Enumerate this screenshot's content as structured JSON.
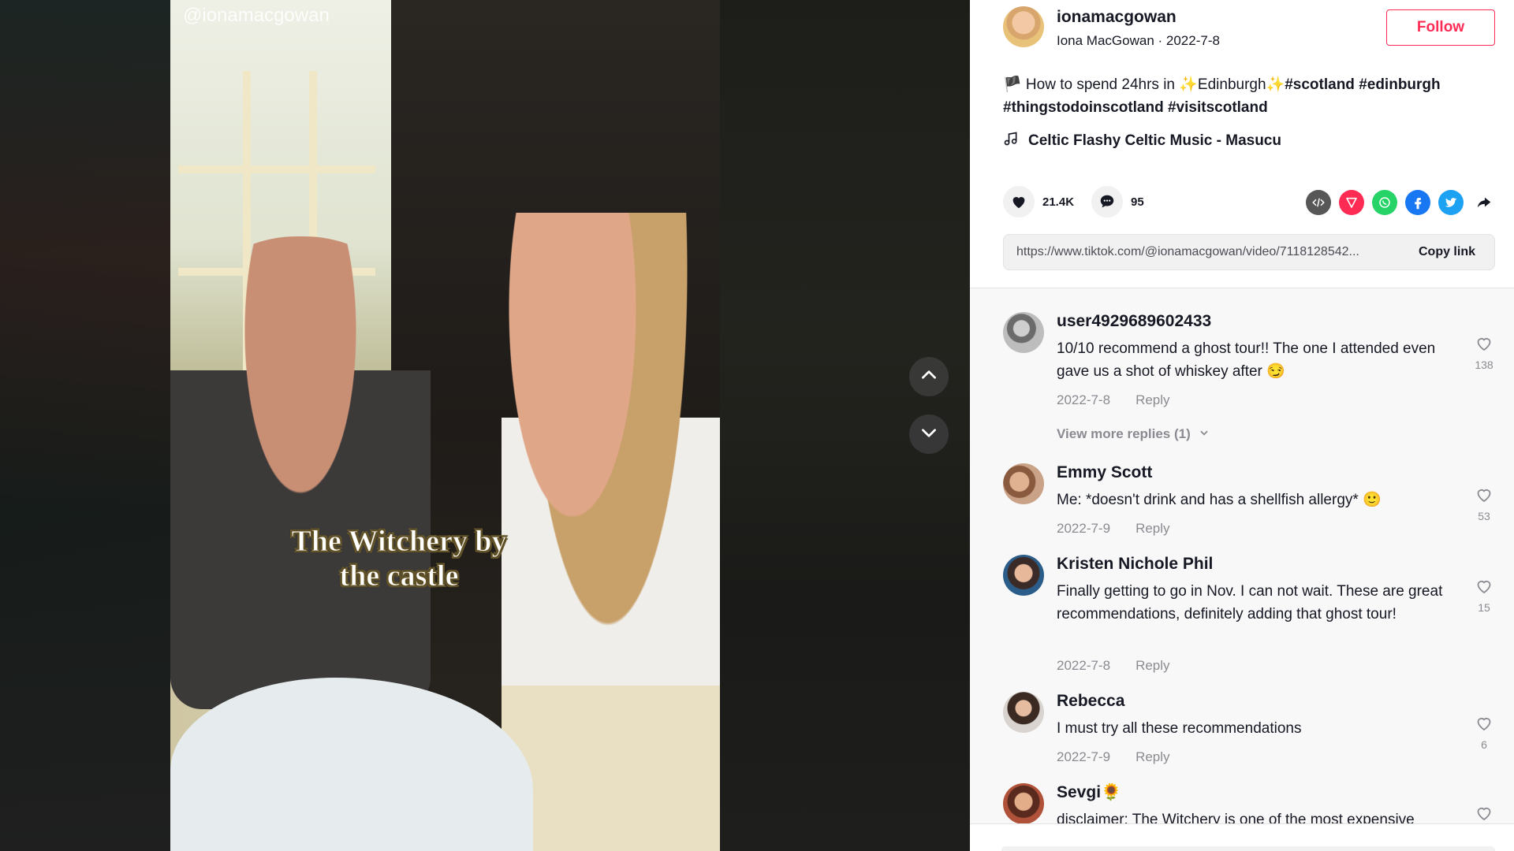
{
  "video": {
    "watermark": "@ionamacgowan",
    "caption": "The Witchery by the castle"
  },
  "post": {
    "username": "ionamacgowan",
    "display_name": "Iona MacGowan",
    "date": "2022-7-8",
    "subline": "Iona MacGowan · 2022-7-8",
    "follow_label": "Follow",
    "description_text": "🏴 How to spend 24hrs in ✨Edinburgh✨",
    "description_tags": "#scotland #edinburgh #thingstodoinscotland #visitscotland",
    "music": "Celtic Flashy Celtic Music - Masucu",
    "likes": "21.4K",
    "comments_count": "95",
    "link_url": "https://www.tiktok.com/@ionamacgowan/video/7118128542...",
    "copy_link_label": "Copy link"
  },
  "colors": {
    "accent": "#fe2c55",
    "text": "#161823",
    "muted": "#8a8b91",
    "share_embed": "#575757",
    "share_send": "#fe2c55",
    "share_whatsapp": "#25d366",
    "share_facebook": "#1877f2",
    "share_twitter": "#1da1f2"
  },
  "comments": [
    {
      "name": "user4929689602433",
      "text": "10/10 recommend a ghost tour!! The one I attended even gave us a shot of whiskey after 😏",
      "date": "2022-7-8",
      "reply": "Reply",
      "likes": "138",
      "more_replies": "View more replies (1)"
    },
    {
      "name": "Emmy Scott",
      "text": "Me: *doesn't drink and has a shellfish allergy* 🙂",
      "date": "2022-7-9",
      "reply": "Reply",
      "likes": "53"
    },
    {
      "name": "Kristen Nichole Phil",
      "text": "Finally getting to go in Nov. I can not wait. These are great recommendations, definitely adding that ghost tour!",
      "date": "2022-7-8",
      "reply": "Reply",
      "likes": "15"
    },
    {
      "name": "Rebecca",
      "text": "I must try all these recommendations",
      "date": "2022-7-9",
      "reply": "Reply",
      "likes": "6"
    },
    {
      "name": "Sevgi🌻",
      "text": "disclaimer: The Witchery is one of the most expensive"
    }
  ]
}
